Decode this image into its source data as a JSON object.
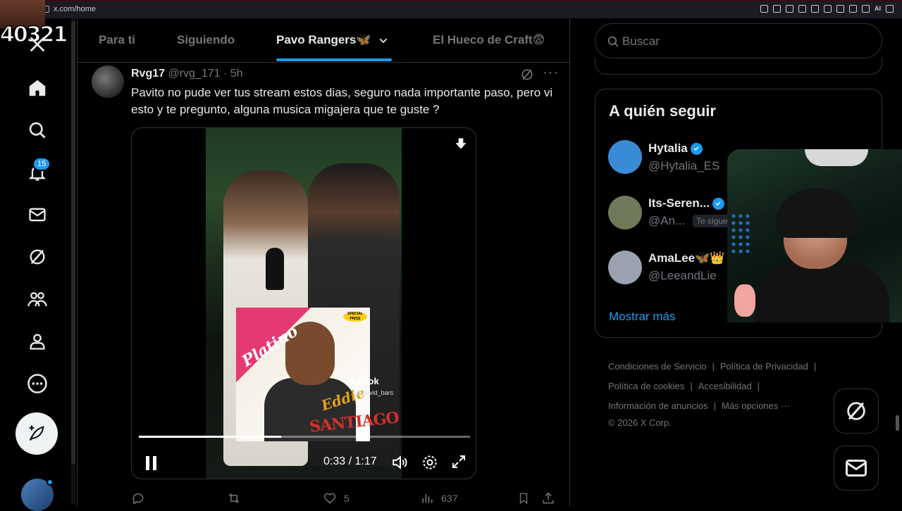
{
  "browser": {
    "url": "x.com/home"
  },
  "overlay": {
    "counter": "40321"
  },
  "nav": {
    "notifications_badge": "15"
  },
  "tabs": [
    {
      "label": "Para ti"
    },
    {
      "label": "Siguiendo"
    },
    {
      "label": "Pavo Rangers🦋"
    },
    {
      "label": "El Hueco de Craft😨"
    }
  ],
  "post": {
    "name": "Rvg17",
    "handle": "@rvg_171",
    "time": "· 5h",
    "text": "Pavito no pude ver tus stream estos dias, seguro nada importante paso, pero vi esto y te pregunto, alguna musica migajera que te guste ?",
    "video": {
      "current_time": "0:33",
      "duration": "1:17",
      "progress": 0.43,
      "watermark": "TikTok",
      "watermark_handle": "@david_bars",
      "album": {
        "top_text": "Platino",
        "name1": "Eddie",
        "name2": "SANTIAGO",
        "sticker": "SPECIAL PRICE"
      }
    },
    "likes": "5",
    "views": "637"
  },
  "search": {
    "placeholder": "Buscar"
  },
  "who_to_follow": {
    "title": "A quién seguir",
    "accounts": [
      {
        "name": "Hytalia",
        "handle": "@Hytalia_ES",
        "avatar_color": "#3a8bd6"
      },
      {
        "name": "Its-Seren...",
        "handle": "@An...",
        "badge": "Te sigue",
        "avatar_color": "#6f7a5a"
      },
      {
        "name": "AmaLee🦋👑",
        "handle": "@LeeandLie",
        "avatar_color": "#9aa2b0"
      }
    ],
    "show_more": "Mostrar más"
  },
  "footer": {
    "links": [
      "Condiciones de Servicio",
      "Política de Privacidad",
      "Política de cookies",
      "Accesibilidad",
      "Información de anuncios",
      "Más opciones ···"
    ],
    "copyright": "© 2026 X Corp."
  },
  "colors": {
    "accent": "#1d9bf0",
    "background": "#000000",
    "border": "#2f3336",
    "muted": "#71767b",
    "text": "#e7e9ea"
  }
}
